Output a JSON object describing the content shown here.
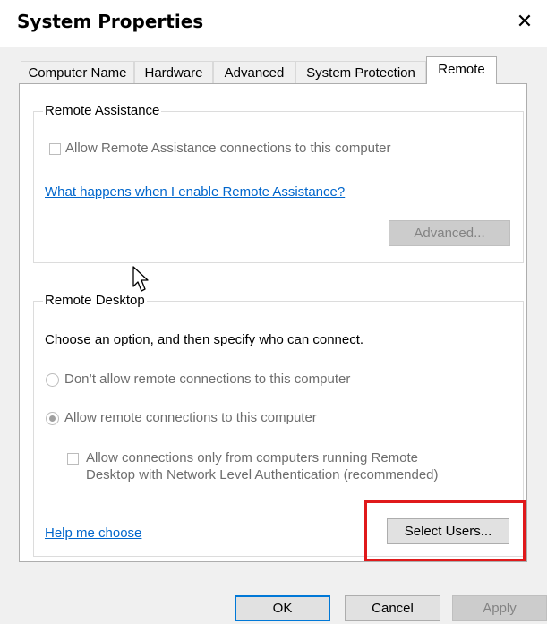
{
  "window": {
    "title": "System Properties",
    "close_glyph": "✕"
  },
  "tabs": [
    {
      "label": "Computer Name"
    },
    {
      "label": "Hardware"
    },
    {
      "label": "Advanced"
    },
    {
      "label": "System Protection"
    },
    {
      "label": "Remote"
    }
  ],
  "active_tab": "Remote",
  "remote_assistance": {
    "legend": "Remote Assistance",
    "allow_checkbox_label": "Allow Remote Assistance connections to this computer",
    "allow_checked": false,
    "help_link": "What happens when I enable Remote Assistance?",
    "advanced_button": "Advanced..."
  },
  "remote_desktop": {
    "legend": "Remote Desktop",
    "instruction": "Choose an option, and then specify who can connect.",
    "option_disallow": "Don’t allow remote connections to this computer",
    "option_allow": "Allow remote connections to this computer",
    "selected_option": "Allow remote connections to this computer",
    "nla_line1": "Allow connections only from computers running Remote",
    "nla_line2": "Desktop with Network Level Authentication (recommended)",
    "nla_checked": false,
    "help_link": "Help me choose",
    "select_users_button": "Select Users..."
  },
  "footer": {
    "ok": "OK",
    "cancel": "Cancel",
    "apply": "Apply"
  },
  "colors": {
    "highlight": "#e0191b",
    "link": "#0066cc",
    "accent": "#0078d7"
  },
  "icons": {
    "cursor": "arrow-cursor-icon",
    "close": "close-icon"
  }
}
